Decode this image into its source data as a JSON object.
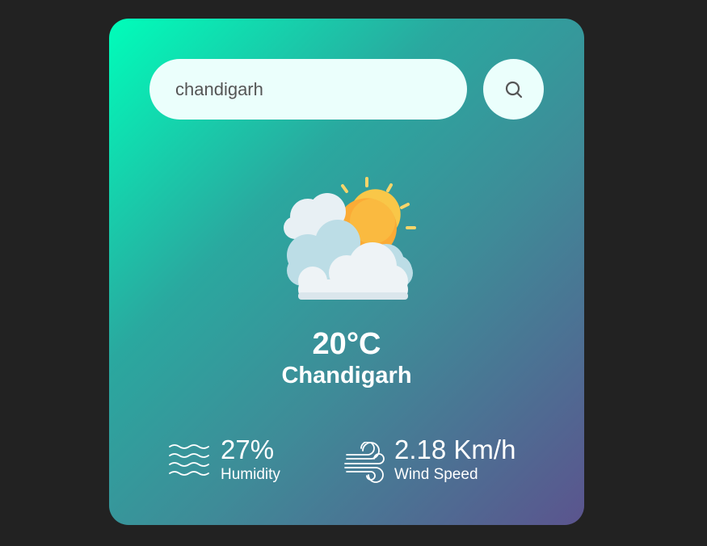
{
  "search": {
    "value": "chandigarh",
    "button_icon": "search-icon"
  },
  "weather": {
    "icon": "partly-cloudy-sun-icon",
    "temperature": "20°C",
    "city": "Chandigarh"
  },
  "details": {
    "humidity": {
      "icon": "humidity-waves-icon",
      "value": "27%",
      "label": "Humidity"
    },
    "wind": {
      "icon": "wind-icon",
      "value": "2.18 Km/h",
      "label": "Wind Speed"
    }
  },
  "colors": {
    "page_background": "#222222",
    "card_gradient_start": "#00feba",
    "card_gradient_end": "#5b548e",
    "input_background": "#ebfffc",
    "text": "#ffffff"
  }
}
